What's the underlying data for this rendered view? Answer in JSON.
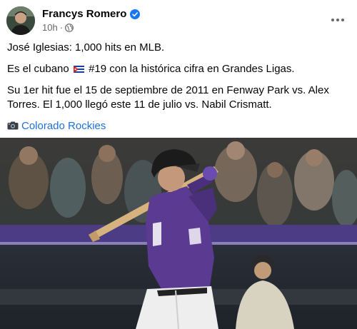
{
  "post": {
    "author": "Francys Romero",
    "time": "10h",
    "separator": "·",
    "paragraphs": {
      "p1": "José Iglesias: 1,000 hits en MLB.",
      "p2_before_flag": "Es el cubano",
      "p2_after_flag": "#19 con la histórica cifra en Grandes Ligas.",
      "p3": "Su 1er hit fue el 15 de septiembre de 2011 en Fenway Park vs. Alex Torres. El 1,000 llegó este 11 de julio vs. Nabil Crismatt."
    },
    "photo_credit_link": "Colorado Rockies",
    "icons": {
      "verified": "verified-badge-icon",
      "audience": "globe-icon",
      "menu": "more-options-icon",
      "flag": "cuba-flag-icon",
      "camera": "camera-icon"
    },
    "colors": {
      "verified_blue": "#1877f2",
      "link_blue": "#216fdb",
      "meta_gray": "#65676b",
      "jersey_purple": "#5b3a92"
    }
  }
}
